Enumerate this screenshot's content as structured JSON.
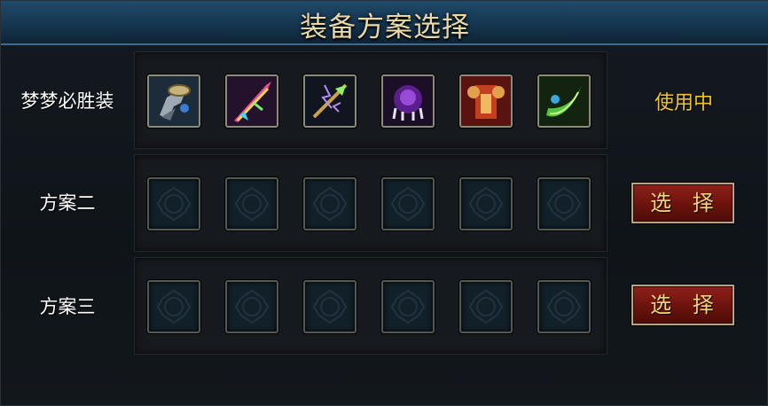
{
  "window": {
    "title": "装备方案选择"
  },
  "plans": [
    {
      "name": "梦梦必胜装",
      "status": "使用中",
      "items": [
        {
          "icon": "boots-icon",
          "filled": true
        },
        {
          "icon": "rainbow-sword-icon",
          "filled": true
        },
        {
          "icon": "lightning-spear-icon",
          "filled": true
        },
        {
          "icon": "purple-claw-amulet-icon",
          "filled": true
        },
        {
          "icon": "red-armor-icon",
          "filled": true
        },
        {
          "icon": "green-blade-icon",
          "filled": true
        }
      ]
    },
    {
      "name": "方案二",
      "button": "选 择",
      "items": [
        {
          "icon": "empty-slot-icon",
          "filled": false
        },
        {
          "icon": "empty-slot-icon",
          "filled": false
        },
        {
          "icon": "empty-slot-icon",
          "filled": false
        },
        {
          "icon": "empty-slot-icon",
          "filled": false
        },
        {
          "icon": "empty-slot-icon",
          "filled": false
        },
        {
          "icon": "empty-slot-icon",
          "filled": false
        }
      ]
    },
    {
      "name": "方案三",
      "button": "选 择",
      "items": [
        {
          "icon": "empty-slot-icon",
          "filled": false
        },
        {
          "icon": "empty-slot-icon",
          "filled": false
        },
        {
          "icon": "empty-slot-icon",
          "filled": false
        },
        {
          "icon": "empty-slot-icon",
          "filled": false
        },
        {
          "icon": "empty-slot-icon",
          "filled": false
        },
        {
          "icon": "empty-slot-icon",
          "filled": false
        }
      ]
    }
  ],
  "colors": {
    "title_text": "#e9d9a6",
    "status_text": "#f2c232",
    "button_bg": "#7a1a12",
    "button_text": "#f3d57a"
  }
}
